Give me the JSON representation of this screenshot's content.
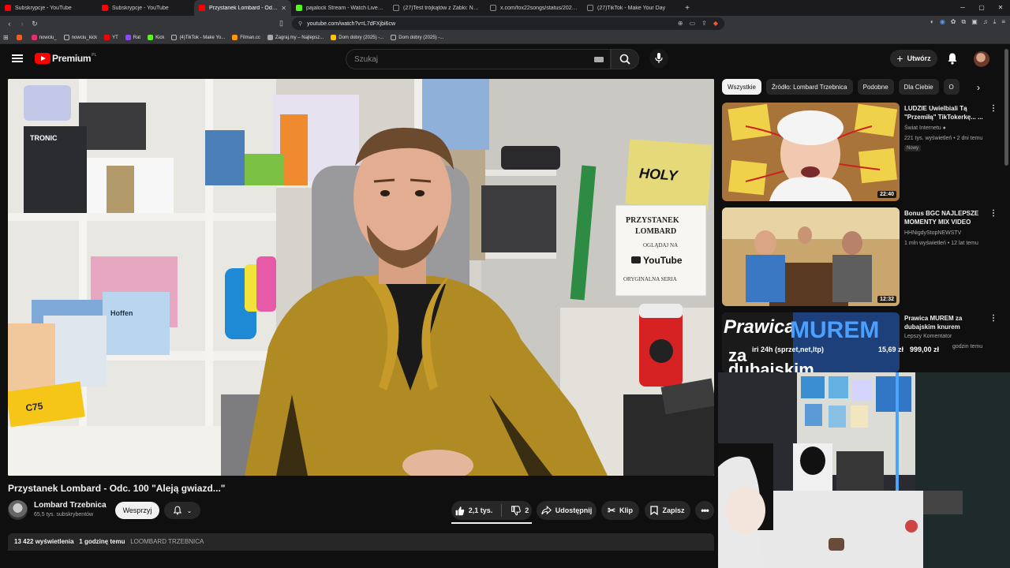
{
  "browser": {
    "tabs": [
      {
        "label": "Subskrypcje - YouTube",
        "color": "#ff0000"
      },
      {
        "label": "Subskrypcje - YouTube",
        "color": "#ff0000"
      },
      {
        "label": "Przystanek Lombard - Odc. 1...",
        "color": "#ff0000",
        "active": true
      },
      {
        "label": "pajalock Stream - Watch Live on Kick",
        "color": "#53fc18"
      },
      {
        "label": "(27)Test trójkątów z Żabki: Najlepsze...",
        "color": "#ffffff"
      },
      {
        "label": "x.com/fox22songs/status/20285901...",
        "color": "#ffffff"
      },
      {
        "label": "(27)TikTok - Make Your Day",
        "color": "#ffffff"
      }
    ],
    "url": "youtube.com/watch?v=L7dFXjbi6cw",
    "bookmarks": [
      {
        "label": "",
        "color": "#ff5722"
      },
      {
        "label": "nowciu_",
        "color": "#e1306c"
      },
      {
        "label": "nowciu_kick",
        "color": "#ffffff"
      },
      {
        "label": "YT",
        "color": "#ff0000"
      },
      {
        "label": "Rat",
        "color": "#9146ff"
      },
      {
        "label": "Kick",
        "color": "#53fc18"
      },
      {
        "label": "(4)TikTok - Make Yo...",
        "color": "#ffffff"
      },
      {
        "label": "Filman.cc",
        "color": "#ff9800"
      },
      {
        "label": "Zagraj.my – Najlepsz...",
        "color": "#aaaaaa"
      },
      {
        "label": "Dom dobry (2025) -...",
        "color": "#ffc107"
      },
      {
        "label": "Dom dobry (2025) -...",
        "color": "#ffffff"
      }
    ]
  },
  "header": {
    "logo_text": "Premium",
    "logo_region": "PL",
    "search_placeholder": "Szukaj",
    "create_label": "Utwórz"
  },
  "video": {
    "title": "Przystanek Lombard - Odc. 100 \"Aleją gwiazd...\"",
    "sign_holy": "HOLY",
    "sign_lines": [
      "PRZYSTANEK",
      "LOMBARD",
      "OGLĄDAJ NA",
      "YouTube",
      "ORYGINALNA SERIA"
    ],
    "box_brand_1": "TRONIC",
    "box_brand_2": "Hoffen",
    "box_brand_3": "C75"
  },
  "channel": {
    "name": "Lombard Trzebnica",
    "subscribers": "65,5 tys. subskrybentów",
    "support_label": "Wesprzyj"
  },
  "actions": {
    "likes": "2,1 tys.",
    "dislikes": "2",
    "share": "Udostępnij",
    "clip": "Klip",
    "save": "Zapisz"
  },
  "description": {
    "views": "13 422 wyświetlenia",
    "time": "1 godzinę temu",
    "tag": "LOOMBARD TRZEBNICA"
  },
  "chips": [
    "Wszystkie",
    "Źródło: Lombard Trzebnica",
    "Podobne",
    "Dla Ciebie",
    "O"
  ],
  "recommendations": [
    {
      "title": "LUDZIE Uwielbiali Tą \"Przemiłą\" TikTokerkę... ...",
      "channel": "Świat Internetu",
      "meta": "221 tys. wyświetleń • 2 dni temu",
      "badge": "Nowy",
      "duration": "22:40"
    },
    {
      "title": "Bonus BGC NAJLEPSZE MOMENTY MIX VIDEO",
      "channel": "HHNigdyStopNEWSTV",
      "meta": "1 mln wyświetleń • 12 lat temu",
      "duration": "12:32"
    },
    {
      "title": "Prawica MUREM za dubajskim knurem",
      "channel": "Lepszy Komentator",
      "meta": "godzin temu",
      "thumb_big": "Prawica",
      "thumb_murem": "MUREM",
      "thumb_sub": "za",
      "thumb_sub2": "dubajskim"
    }
  ],
  "overlay": {
    "label": "iri 24h (sprzet,net,ltp)",
    "price1": "15,69 zł",
    "price2": "999,00 zł"
  }
}
